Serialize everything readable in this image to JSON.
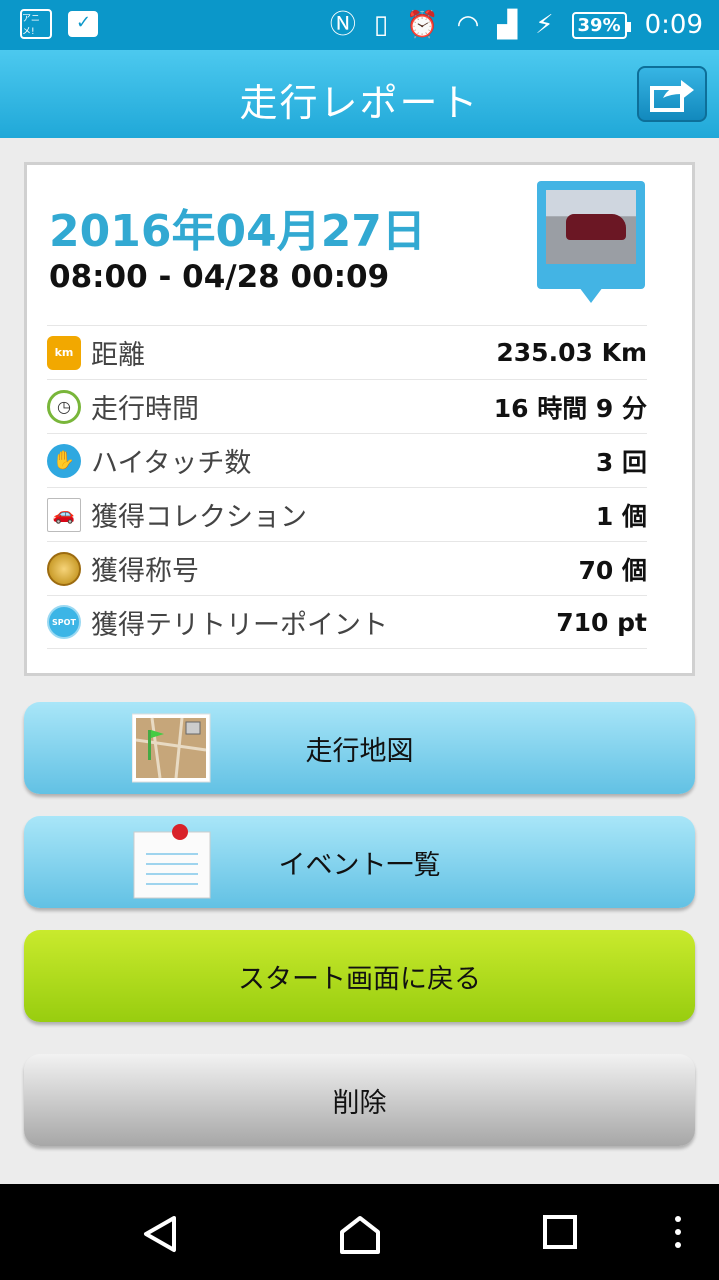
{
  "status_bar": {
    "app_badge": "アニメ!",
    "battery": "39%",
    "time": "0:09"
  },
  "header": {
    "title": "走行レポート"
  },
  "summary": {
    "date": "2016年04月27日",
    "time_range": "08:00 - 04/28 00:09",
    "stats": [
      {
        "icon": "km-icon",
        "label": "距離",
        "value": "235.03 Km"
      },
      {
        "icon": "clock-icon",
        "label": "走行時間",
        "value": "16 時間 9 分"
      },
      {
        "icon": "high-five-icon",
        "label": "ハイタッチ数",
        "value": "3 回"
      },
      {
        "icon": "car-icon",
        "label": "獲得コレクション",
        "value": "1 個"
      },
      {
        "icon": "medal-icon",
        "label": "獲得称号",
        "value": "70 個"
      },
      {
        "icon": "spot-icon",
        "label": "獲得テリトリーポイント",
        "value": "710 pt"
      }
    ]
  },
  "buttons": {
    "map": "走行地図",
    "events": "イベント一覧",
    "back_to_start": "スタート画面に戻る",
    "delete": "削除"
  },
  "colors": {
    "status_bar": "#0b97c9",
    "header": "#2bb4e3",
    "date_text": "#32a9d2",
    "blue_button": "#7fd0ec",
    "green_button": "#b0dc1c",
    "gray_button": "#c8c8c8"
  }
}
